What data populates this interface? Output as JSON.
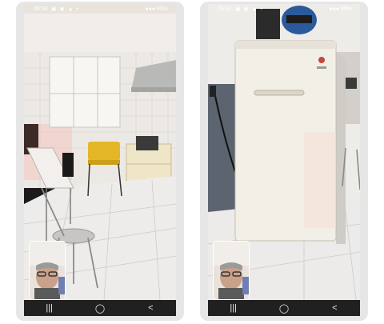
{
  "left_call": {
    "status_time": "09:33",
    "status_icons": "▣ ◉ ▲ •",
    "status_right": "●●● 85%",
    "nav_recents": "|||",
    "nav_home": "◯",
    "nav_back": "<"
  },
  "right_call": {
    "status_time": "09:33",
    "status_icons": "▣ ◉ ▲ •",
    "status_right": "●●● 85%",
    "nav_recents": "|||",
    "nav_home": "◯",
    "nav_back": "<"
  }
}
